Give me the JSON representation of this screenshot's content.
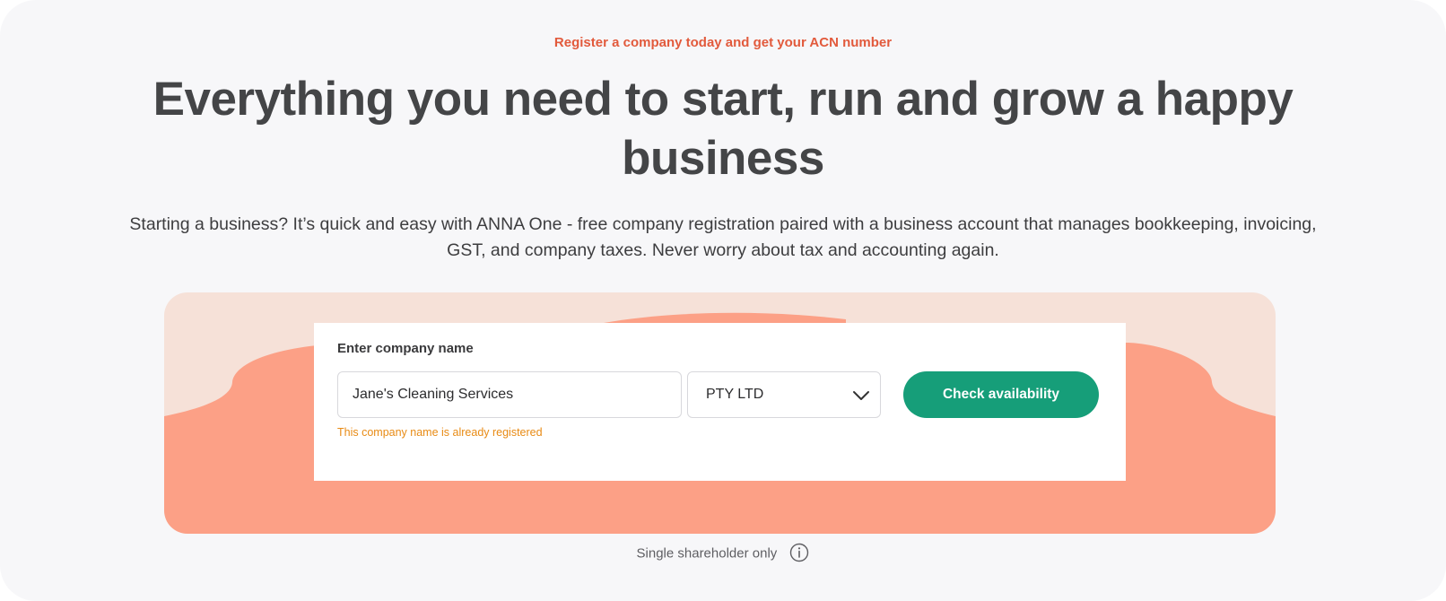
{
  "hero": {
    "eyebrow": "Register a company today and get your ACN number",
    "title": "Everything you need to start, run and grow a happy business",
    "subtitle": "Starting a business? It’s quick and easy with ANNA One - free company registration paired with a business account that manages bookkeeping, invoicing, GST, and company taxes. Never worry about tax and accounting again."
  },
  "form": {
    "label": "Enter company name",
    "company_name_value": "Jane's Cleaning Services",
    "company_type_selected": "PTY LTD",
    "error_message": "This company name is already registered",
    "check_button_label": "Check availability"
  },
  "footer": {
    "note": "Single shareholder only",
    "info_icon": "info-circle-icon"
  },
  "colors": {
    "accent_orange": "#e25a3c",
    "panel_peach": "#fca086",
    "panel_light": "#f6e1d8",
    "button_green": "#169e79",
    "error_orange": "#e88b15",
    "title_gray": "#444547"
  }
}
